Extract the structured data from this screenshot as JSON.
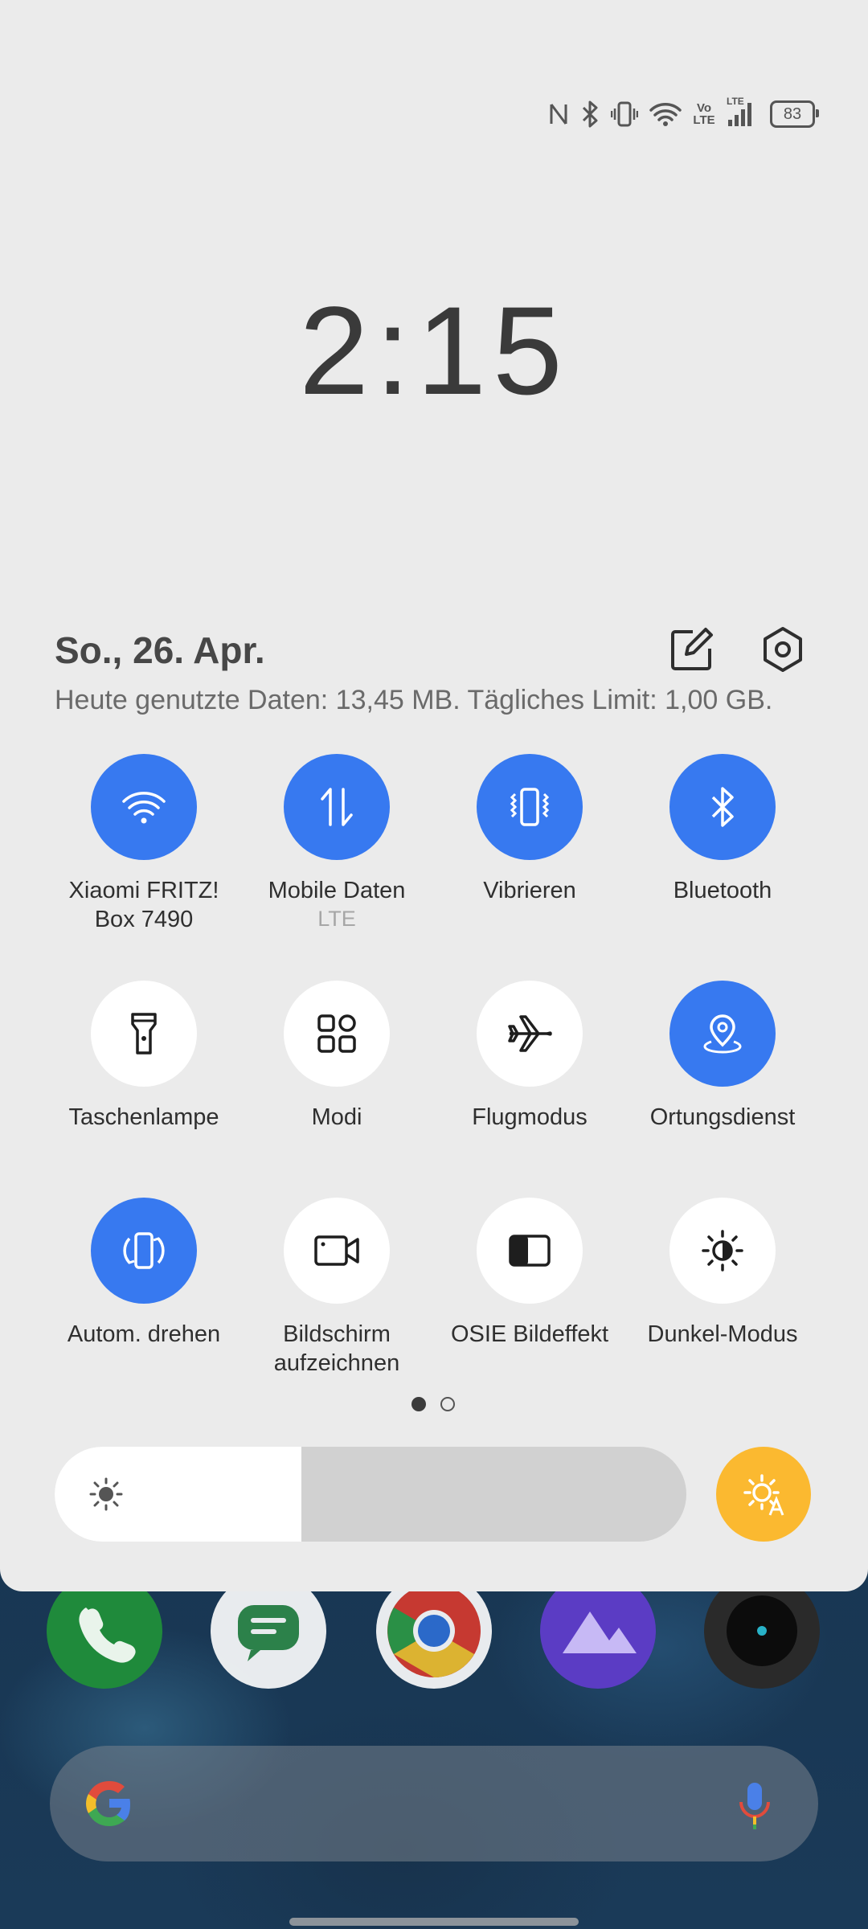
{
  "status_bar": {
    "icons": [
      "nfc-icon",
      "bluetooth-icon",
      "vibrate-icon",
      "wifi-icon",
      "volte-icon",
      "lte-signal-icon"
    ],
    "volte_label": "Vo LTE",
    "lte_label": "LTE",
    "battery": "83"
  },
  "clock": "2:15",
  "header": {
    "date": "So., 26. Apr.",
    "data_usage": "Heute genutzte Daten: 13,45 MB. Tägliches Limit: 1,00 GB."
  },
  "tiles": [
    {
      "label": "Xiaomi FRITZ! Box 7490",
      "sub": "",
      "on": true,
      "icon": "wifi-icon"
    },
    {
      "label": "Mobile Daten",
      "sub": "LTE",
      "on": true,
      "icon": "mobile-data-icon"
    },
    {
      "label": "Vibrieren",
      "sub": "",
      "on": true,
      "icon": "vibrate-icon"
    },
    {
      "label": "Bluetooth",
      "sub": "",
      "on": true,
      "icon": "bluetooth-icon"
    },
    {
      "label": "Taschenlampe",
      "sub": "",
      "on": false,
      "icon": "flashlight-icon"
    },
    {
      "label": "Modi",
      "sub": "",
      "on": false,
      "icon": "modes-grid-icon"
    },
    {
      "label": "Flugmodus",
      "sub": "",
      "on": false,
      "icon": "airplane-icon"
    },
    {
      "label": "Ortungsdienst",
      "sub": "",
      "on": true,
      "icon": "location-icon"
    },
    {
      "label": "Autom. drehen",
      "sub": "",
      "on": true,
      "icon": "auto-rotate-icon"
    },
    {
      "label": "Bildschirm aufzeichnen",
      "sub": "",
      "on": false,
      "icon": "screen-record-icon"
    },
    {
      "label": "OSIE Bildeffekt",
      "sub": "",
      "on": false,
      "icon": "osie-effect-icon"
    },
    {
      "label": "Dunkel-Modus",
      "sub": "",
      "on": false,
      "icon": "dark-mode-icon"
    }
  ],
  "pager": {
    "pages": 2,
    "current": 1
  },
  "brightness": {
    "level": 0.39,
    "auto": true
  },
  "colors": {
    "accent": "#3779f0",
    "shade_bg": "#ebebeb",
    "auto_brightness": "#fbb930"
  },
  "dock": [
    "phone-app-icon",
    "messages-app-icon",
    "chrome-app-icon",
    "gallery-app-icon",
    "camera-app-icon"
  ],
  "search": {
    "icons": [
      "google-g-icon",
      "microphone-icon"
    ]
  }
}
